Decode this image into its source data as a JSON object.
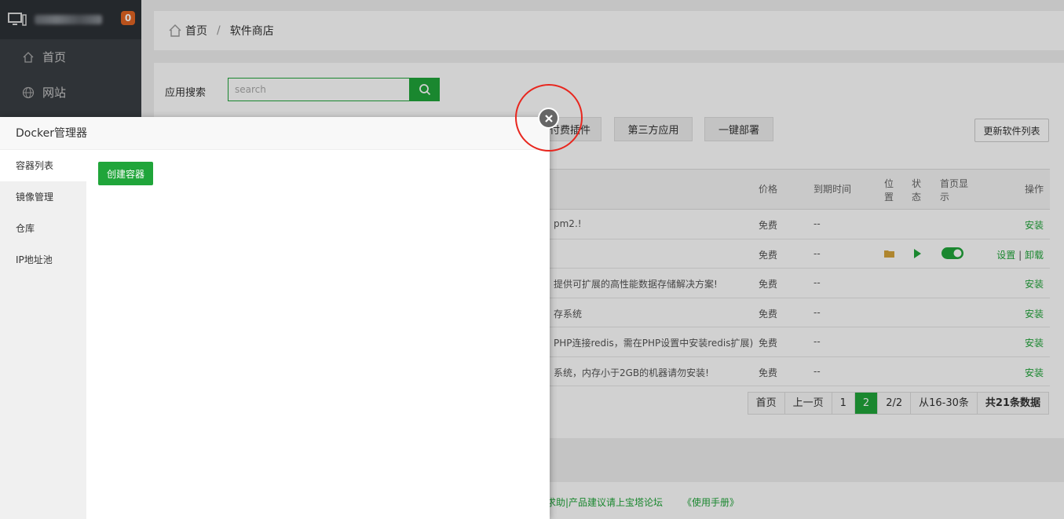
{
  "sidebar": {
    "badge": "0",
    "items": [
      {
        "label": "首页",
        "icon": "home-icon"
      },
      {
        "label": "网站",
        "icon": "globe-icon"
      }
    ]
  },
  "breadcrumb": {
    "home": "首页",
    "separator": "/",
    "current": "软件商店"
  },
  "search": {
    "label": "应用搜索",
    "placeholder": "search"
  },
  "categories": [
    "付费插件",
    "第三方应用",
    "一键部署"
  ],
  "update_button": "更新软件列表",
  "table": {
    "headers": {
      "price": "价格",
      "expire": "到期时间",
      "location": "位置",
      "status": "状态",
      "homepage": "首页显示",
      "action": "操作"
    },
    "rows": [
      {
        "desc": "pm2.!",
        "price": "免费",
        "expire": "--",
        "action": "安装"
      },
      {
        "desc": "",
        "price": "免费",
        "expire": "--",
        "action_set": "设置",
        "action_sep": "|",
        "action_uninstall": "卸载"
      },
      {
        "desc": "提供可扩展的高性能数据存储解决方案!",
        "price": "免费",
        "expire": "--",
        "action": "安装"
      },
      {
        "desc": "存系统",
        "price": "免费",
        "expire": "--",
        "action": "安装"
      },
      {
        "desc": "PHP连接redis，需在PHP设置中安装redis扩展)",
        "price": "免费",
        "expire": "--",
        "action": "安装"
      },
      {
        "desc": "系统，内存小于2GB的机器请勿安装!",
        "price": "免费",
        "expire": "--",
        "action": "安装"
      }
    ]
  },
  "pager": {
    "first": "首页",
    "prev": "上一页",
    "p1": "1",
    "p2": "2",
    "total_pages": "2/2",
    "range": "从16-30条",
    "count": "共21条数据"
  },
  "footer": {
    "text1": "求助|产品建议请上宝塔论坛",
    "text2": "《使用手册》"
  },
  "modal": {
    "title": "Docker管理器",
    "nav": [
      "容器列表",
      "镜像管理",
      "仓库",
      "IP地址池"
    ],
    "create_button": "创建容器"
  },
  "colors": {
    "accent": "#20a53a",
    "sidebar": "#3a3f44",
    "badge": "#e26423",
    "highlight": "#e8261e"
  }
}
